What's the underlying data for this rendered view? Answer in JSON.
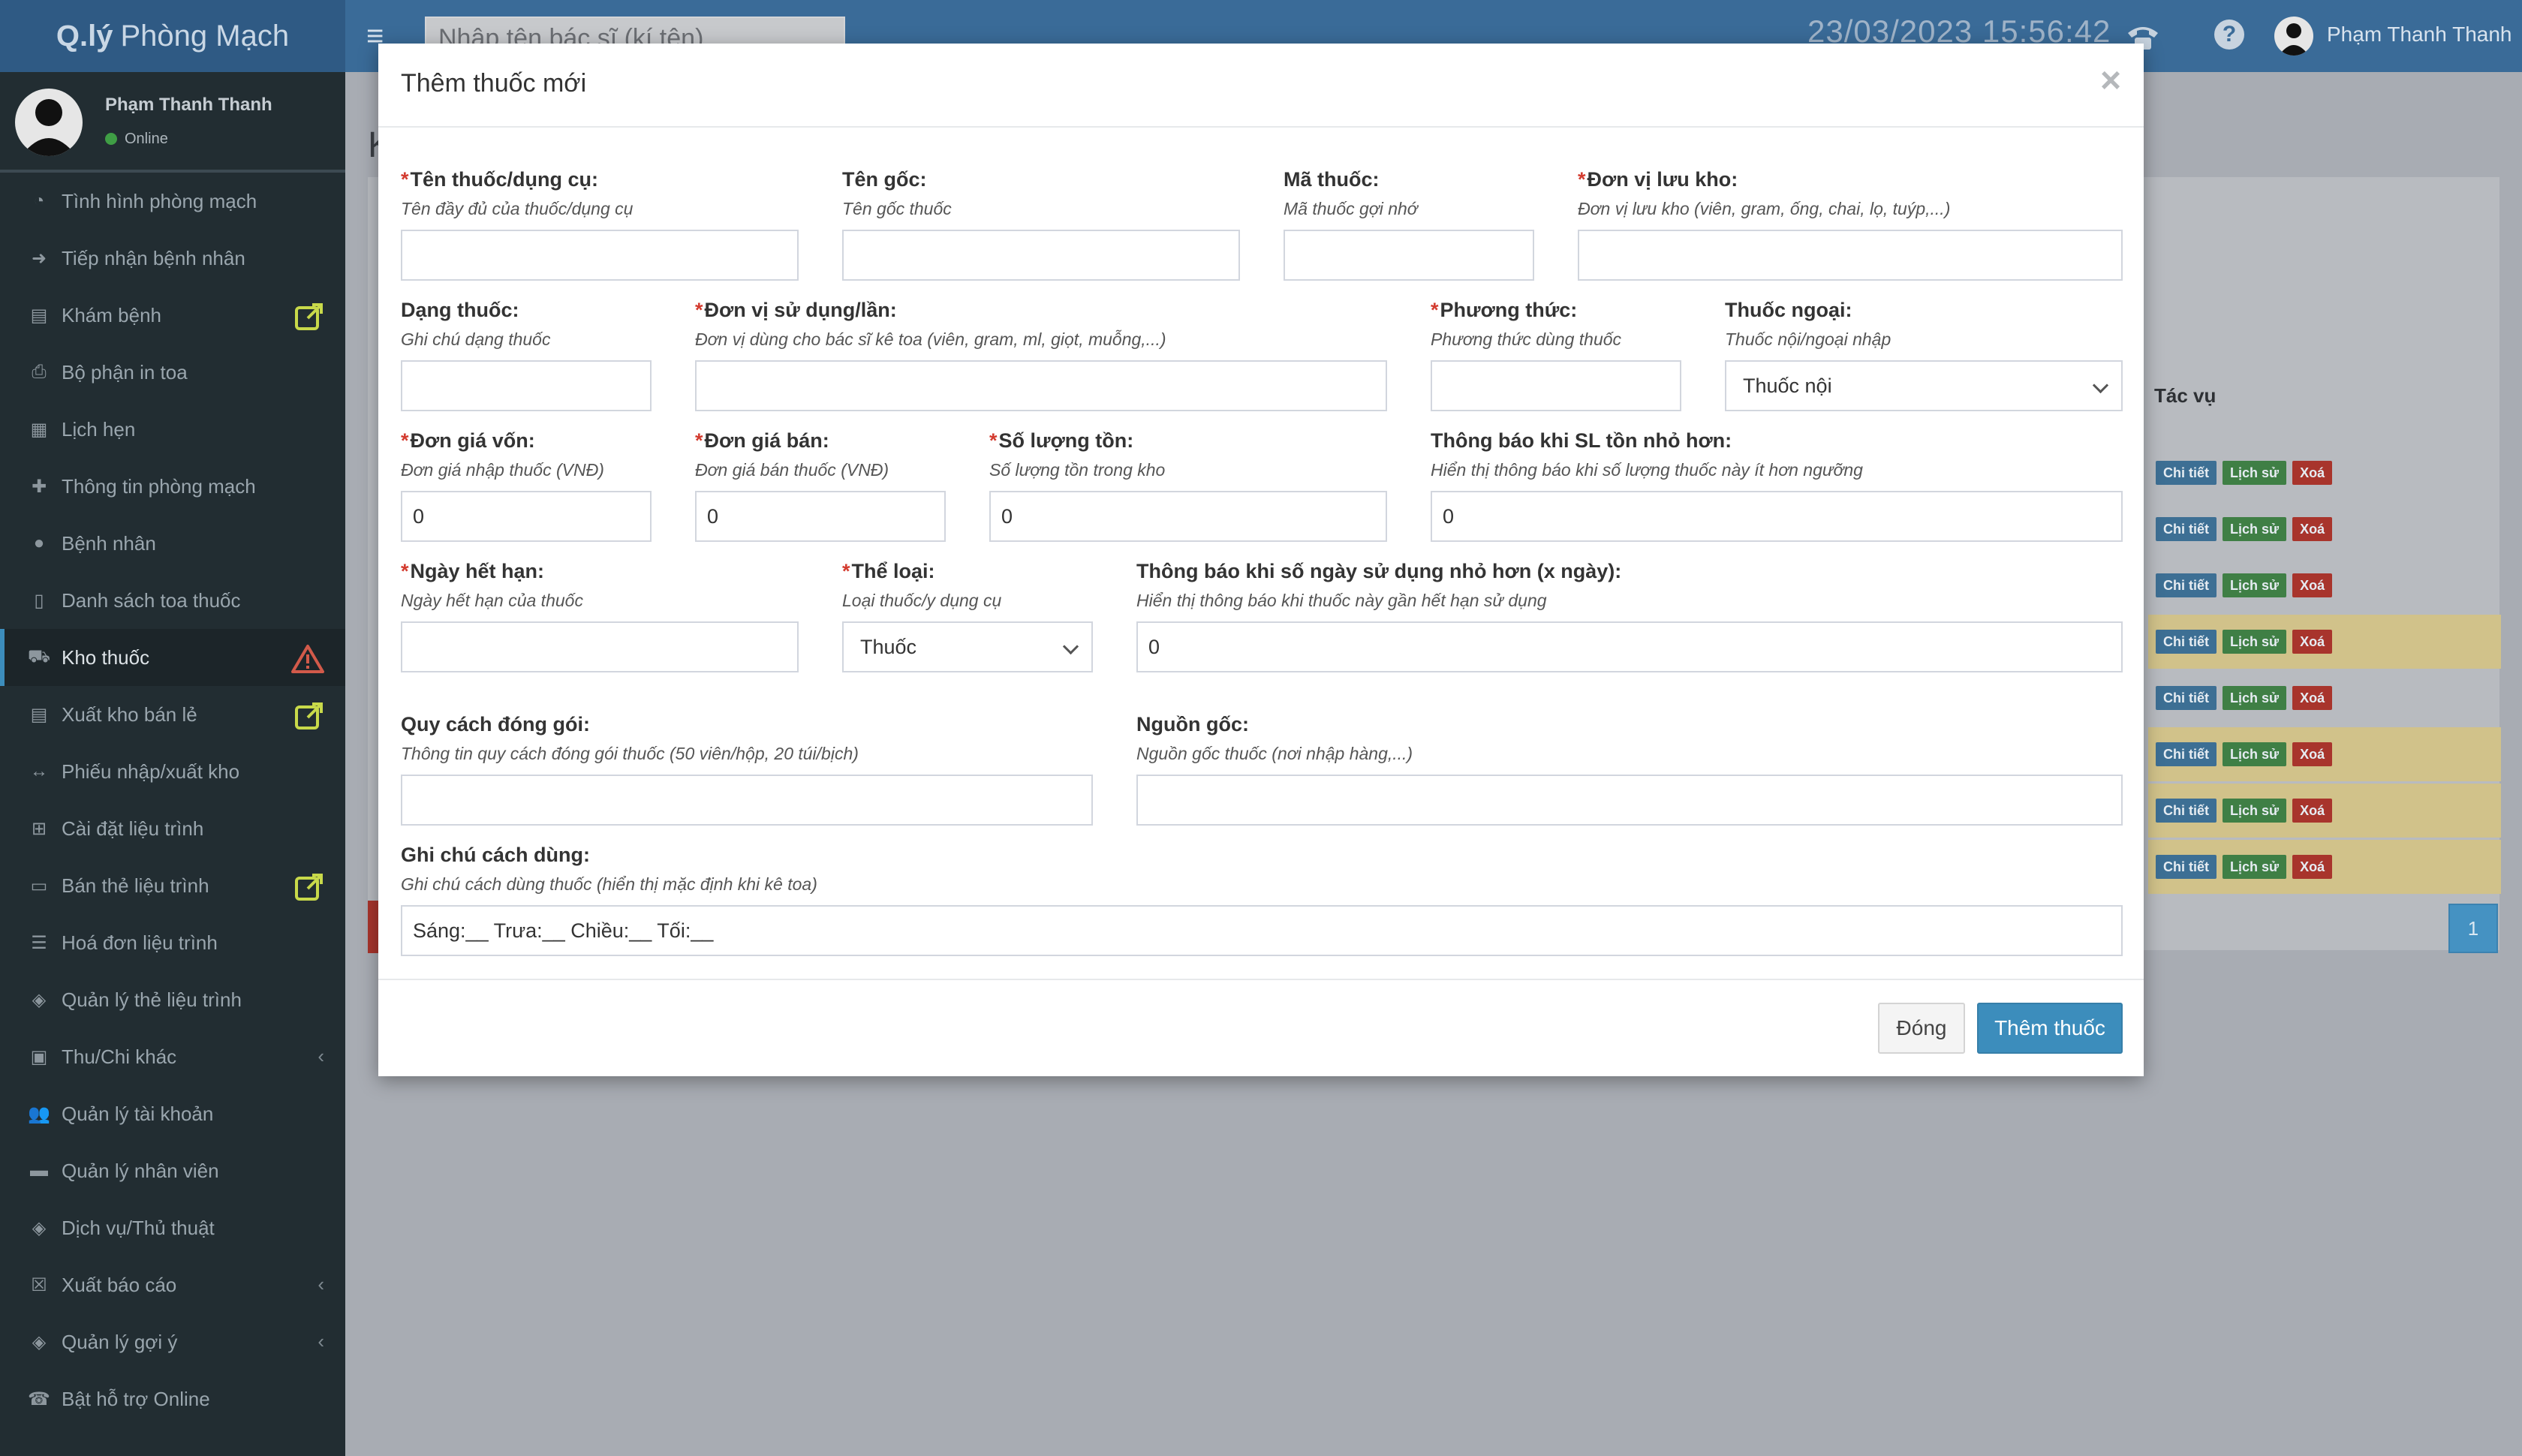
{
  "header": {
    "logo_strong": "Q.lý",
    "logo_rest": "Phòng Mạch",
    "search_placeholder": "Nhập tên bác sĩ (kí tên)",
    "datetime": "23/03/2023  15:56:42",
    "user_name": "Phạm Thanh Thanh",
    "help_glyph": "?"
  },
  "sidebar": {
    "user_name": "Phạm Thanh Thanh",
    "status": "Online",
    "items": [
      {
        "label": "Tình hình phòng mạch",
        "icon": "dashboard-icon"
      },
      {
        "label": "Tiếp nhận bệnh nhân",
        "icon": "sign-in-icon"
      },
      {
        "label": "Khám bệnh",
        "icon": "clipboard-icon"
      },
      {
        "label": "Bộ phận in toa",
        "icon": "printer-icon"
      },
      {
        "label": "Lịch hẹn",
        "icon": "calendar-icon"
      },
      {
        "label": "Thông tin phòng mạch",
        "icon": "plus-icon"
      },
      {
        "label": "Bệnh nhân",
        "icon": "user-icon"
      },
      {
        "label": "Danh sách toa thuốc",
        "icon": "file-icon"
      },
      {
        "label": "Kho thuốc",
        "icon": "ambulance-icon"
      },
      {
        "label": "Xuất kho bán lẻ",
        "icon": "clipboard-icon"
      },
      {
        "label": "Phiếu nhập/xuất kho",
        "icon": "arrows-h-icon"
      },
      {
        "label": "Cài đặt liệu trình",
        "icon": "table-icon"
      },
      {
        "label": "Bán thẻ liệu trình",
        "icon": "credit-card-icon"
      },
      {
        "label": "Hoá đơn liệu trình",
        "icon": "list-icon"
      },
      {
        "label": "Quản lý thẻ liệu trình",
        "icon": "tags-icon"
      },
      {
        "label": "Thu/Chi khác",
        "icon": "money-icon"
      },
      {
        "label": "Quản lý tài khoản",
        "icon": "users-icon"
      },
      {
        "label": "Quản lý nhân viên",
        "icon": "briefcase-icon"
      },
      {
        "label": "Dịch vụ/Thủ thuật",
        "icon": "tags-icon"
      },
      {
        "label": "Xuất báo cáo",
        "icon": "excel-icon"
      },
      {
        "label": "Quản lý gợi ý",
        "icon": "tags-icon"
      },
      {
        "label": "Bật hỗ trợ Online",
        "icon": "phone-icon"
      }
    ]
  },
  "background": {
    "title": "K",
    "action_col": "Tác vụ",
    "row_buttons": {
      "detail": "Chi tiết",
      "history": "Lịch sử",
      "delete": "Xoá"
    },
    "pagination_current": "1"
  },
  "modal": {
    "title": "Thêm thuốc mới",
    "close_glyph": "×",
    "fields": {
      "ten_thuoc": {
        "label": "Tên thuốc/dụng cụ:",
        "hint": "Tên đầy đủ của thuốc/dụng cụ",
        "value": ""
      },
      "ten_goc": {
        "label": "Tên gốc:",
        "hint": "Tên gốc thuốc",
        "value": ""
      },
      "ma_thuoc": {
        "label": "Mã thuốc:",
        "hint": "Mã thuốc gợi nhớ",
        "value": ""
      },
      "don_vi_luu_kho": {
        "label": "Đơn vị lưu kho:",
        "hint": "Đơn vị lưu kho (viên, gram, ống, chai, lọ, tuýp,...)",
        "value": ""
      },
      "dang_thuoc": {
        "label": "Dạng thuốc:",
        "hint": "Ghi chú dạng thuốc",
        "value": ""
      },
      "don_vi_su_dung": {
        "label": "Đơn vị sử dụng/lần:",
        "hint": "Đơn vị dùng cho bác sĩ kê toa (viên, gram, ml, giọt, muỗng,...)",
        "value": ""
      },
      "phuong_thuc": {
        "label": "Phương thức:",
        "hint": "Phương thức dùng thuốc",
        "value": ""
      },
      "thuoc_ngoai": {
        "label": "Thuốc ngoại:",
        "hint": "Thuốc nội/ngoại nhập",
        "value": "Thuốc nội"
      },
      "don_gia_von": {
        "label": "Đơn giá vốn:",
        "hint": "Đơn giá nhập thuốc (VNĐ)",
        "value": "0"
      },
      "don_gia_ban": {
        "label": "Đơn giá bán:",
        "hint": "Đơn giá bán thuốc (VNĐ)",
        "value": "0"
      },
      "so_luong_ton": {
        "label": "Số lượng tồn:",
        "hint": "Số lượng tồn trong kho",
        "value": "0"
      },
      "thong_bao_sl": {
        "label": "Thông báo khi SL tồn nhỏ hơn:",
        "hint": "Hiển thị thông báo khi số lượng thuốc này ít hơn ngưỡng",
        "value": "0"
      },
      "ngay_het_han": {
        "label": "Ngày hết hạn:",
        "hint": "Ngày hết hạn của thuốc",
        "value": ""
      },
      "the_loai": {
        "label": "Thể loại:",
        "hint": "Loại thuốc/y dụng cụ",
        "value": "Thuốc"
      },
      "thong_bao_ngay": {
        "label": "Thông báo khi số ngày sử dụng nhỏ hơn (x ngày):",
        "hint": "Hiển thị thông báo khi thuốc này gần hết hạn sử dụng",
        "value": "0"
      },
      "quy_cach": {
        "label": "Quy cách đóng gói:",
        "hint": "Thông tin quy cách đóng gói thuốc (50 viên/hộp, 20 túi/bịch)",
        "value": ""
      },
      "nguon_goc": {
        "label": "Nguồn gốc:",
        "hint": "Nguồn gốc thuốc (nơi nhập hàng,...)",
        "value": ""
      },
      "ghi_chu": {
        "label": "Ghi chú cách dùng:",
        "hint": "Ghi chú cách dùng thuốc (hiển thị mặc định khi kê toa)",
        "value": "Sáng:__ Trưa:__ Chiều:__ Tối:__"
      }
    },
    "buttons": {
      "close": "Đóng",
      "submit": "Thêm thuốc"
    }
  },
  "colors": {
    "header": "#3a6b98",
    "sidebar": "#222d32",
    "primary": "#3c8dbc",
    "required": "#d33b2f"
  }
}
